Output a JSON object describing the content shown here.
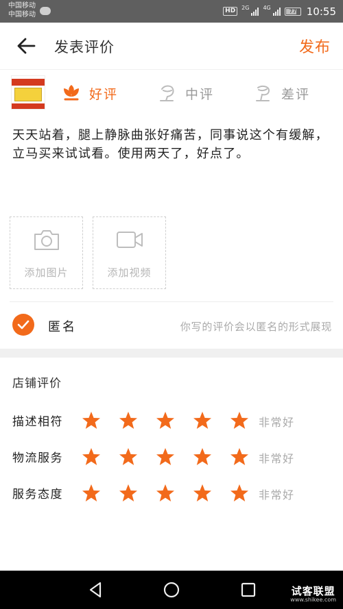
{
  "status_bar": {
    "carrier_1": "中国移动",
    "carrier_2": "中国移动",
    "hd": "HD",
    "net_1": "2G",
    "net_2": "4G",
    "battery": "77",
    "time": "10:55"
  },
  "header": {
    "title": "发表评价",
    "publish_label": "发布"
  },
  "rating": {
    "options": [
      {
        "label": "好评",
        "selected": true
      },
      {
        "label": "中评",
        "selected": false
      },
      {
        "label": "差评",
        "selected": false
      }
    ]
  },
  "review": {
    "text": "天天站着，腿上静脉曲张好痛苦，同事说这个有缓解，立马买来试试看。使用两天了，好点了。"
  },
  "media": {
    "photo_label": "添加图片",
    "video_label": "添加视频"
  },
  "anonymous": {
    "label": "匿名",
    "checked": true,
    "hint": "你写的评价会以匿名的形式展现"
  },
  "store": {
    "title": "店铺评价",
    "rows": [
      {
        "label": "描述相符",
        "stars": 5,
        "value": "非常好"
      },
      {
        "label": "物流服务",
        "stars": 5,
        "value": "非常好"
      },
      {
        "label": "服务态度",
        "stars": 5,
        "value": "非常好"
      }
    ]
  },
  "watermark": {
    "main": "试客联盟",
    "sub": "www.shikee.com"
  },
  "colors": {
    "accent": "#f26a1b",
    "muted": "#aaaaaa",
    "status_bar": "#5f5f5f"
  }
}
